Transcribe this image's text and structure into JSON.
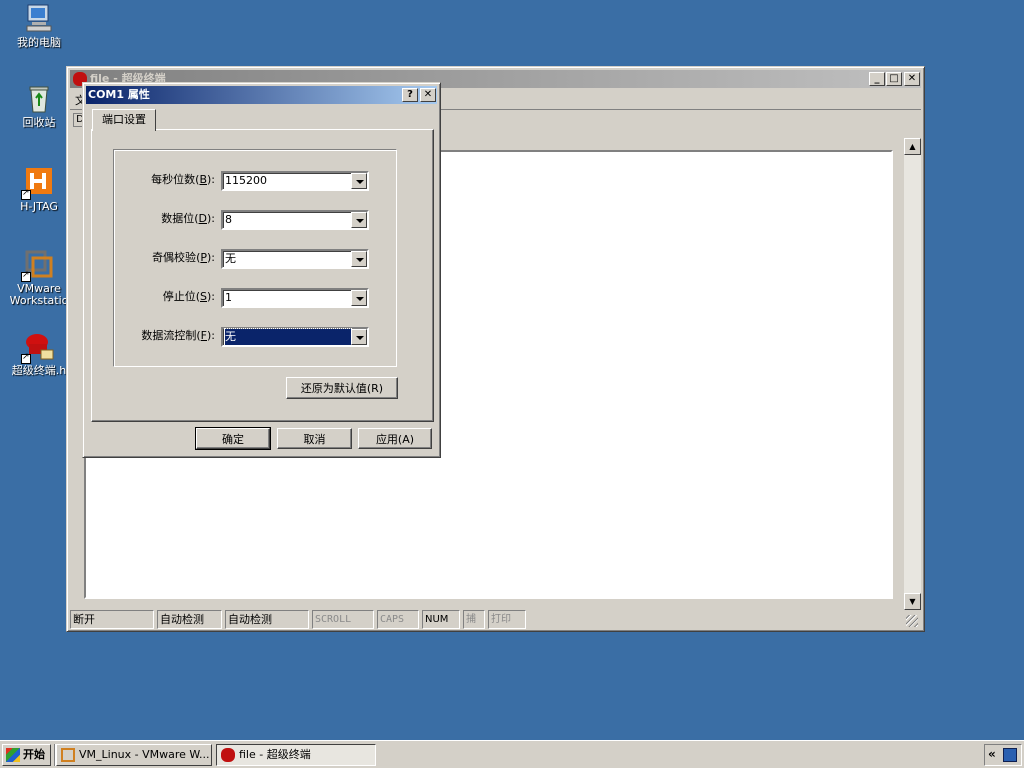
{
  "desktop": {
    "icons": [
      {
        "label": "我的电脑",
        "icon": "my-computer-icon"
      },
      {
        "label": "回收站",
        "icon": "recycle-bin-icon"
      },
      {
        "label": "H-JTAG",
        "icon": "hjtag-icon"
      },
      {
        "label": "VMware\nWorkstatio",
        "icon": "vmware-icon"
      },
      {
        "label": "超级终端.h",
        "icon": "hyperterminal-icon"
      }
    ]
  },
  "main_window": {
    "title": "file - 超级终端",
    "menu_first_letter": "文",
    "toolbar_first": "D",
    "status": [
      "断开",
      "自动检测",
      "自动检测",
      "SCROLL",
      "CAPS",
      "NUM",
      "捕",
      "打印"
    ]
  },
  "dialog": {
    "title": "COM1 属性",
    "help_glyph": "?",
    "close_glyph": "✕",
    "tab": "端口设置",
    "fields": [
      {
        "label": "每秒位数",
        "key": "B",
        "value": "115200"
      },
      {
        "label": "数据位",
        "key": "D",
        "value": "8"
      },
      {
        "label": "奇偶校验",
        "key": "P",
        "value": "无"
      },
      {
        "label": "停止位",
        "key": "S",
        "value": "1"
      },
      {
        "label": "数据流控制",
        "key": "F",
        "value": "无"
      }
    ],
    "restore_button": "还原为默认值(R)",
    "ok": "确定",
    "cancel": "取消",
    "apply": "应用(A)"
  },
  "taskbar": {
    "start": "开始",
    "tasks": [
      "VM_Linux - VMware W...",
      "file - 超级终端"
    ],
    "tray_arrow": "«"
  },
  "colors": {
    "desktop": "#3a6ea5",
    "active_title": "#0a246a",
    "inactive_title": "#808080",
    "face": "#d4d0c8"
  }
}
